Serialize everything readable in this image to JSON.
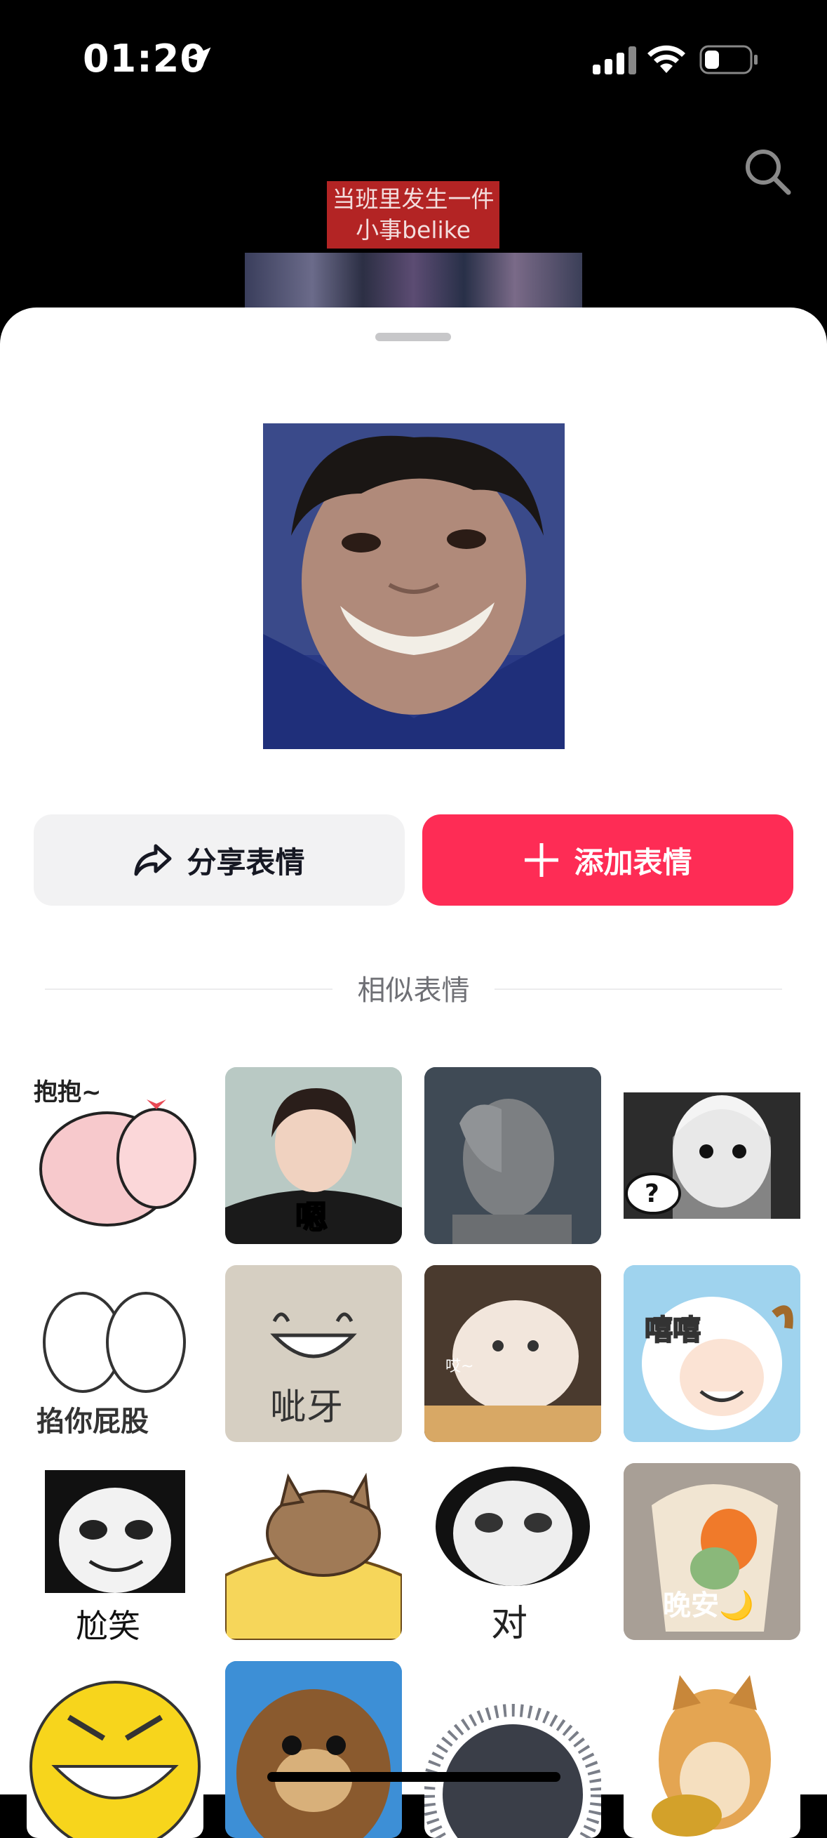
{
  "status_bar": {
    "time": "01:20"
  },
  "video": {
    "caption_line1": "当班里发生一件",
    "caption_line2": "小事belike"
  },
  "sheet": {
    "share_label": "分享表情",
    "add_label": "添加表情",
    "similar_title": "相似表情"
  },
  "stickers": [
    {
      "label": "抱抱~"
    },
    {
      "label": "嗯"
    },
    {
      "label": ""
    },
    {
      "label": "?"
    },
    {
      "label": "掐你屁股"
    },
    {
      "label": "呲牙"
    },
    {
      "label": "哎~"
    },
    {
      "label": "嘻嘻"
    },
    {
      "label": "尬笑"
    },
    {
      "label": ""
    },
    {
      "label": "对"
    },
    {
      "label": "晚安🌙"
    },
    {
      "label": ""
    },
    {
      "label": ""
    },
    {
      "label": ""
    },
    {
      "label": ""
    }
  ],
  "colors": {
    "accent": "#fe2c55",
    "share_bg": "#f2f2f3"
  }
}
